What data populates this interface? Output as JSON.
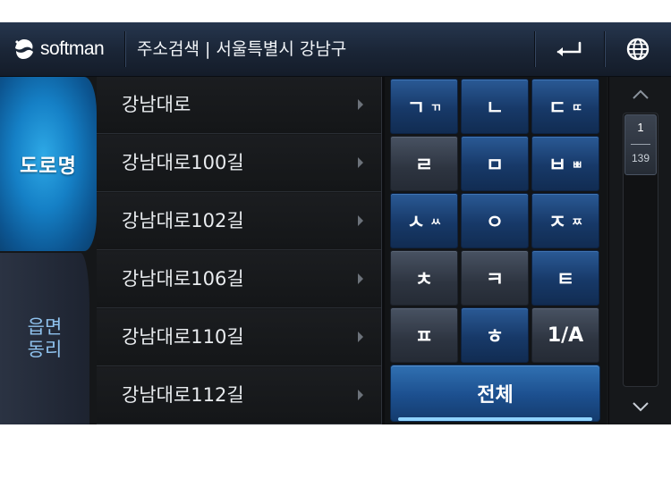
{
  "header": {
    "logo_text": "softman",
    "title": "주소검색 | 서울특별시 강남구",
    "back_icon": "back-arrow-icon",
    "globe_icon": "globe-icon"
  },
  "tabs": {
    "road": "도로명",
    "town": "읍면\n동리",
    "active": "road"
  },
  "list": {
    "items": [
      {
        "label": "강남대로"
      },
      {
        "label": "강남대로100길"
      },
      {
        "label": "강남대로102길"
      },
      {
        "label": "강남대로106길"
      },
      {
        "label": "강남대로110길"
      },
      {
        "label": "강남대로112길"
      }
    ]
  },
  "keypad": {
    "keys": [
      {
        "main": "ㄱ",
        "sub": "ㄲ",
        "style": "blue"
      },
      {
        "main": "ㄴ",
        "sub": "",
        "style": "blue"
      },
      {
        "main": "ㄷ",
        "sub": "ㄸ",
        "style": "blue"
      },
      {
        "main": "ㄹ",
        "sub": "",
        "style": "dark"
      },
      {
        "main": "ㅁ",
        "sub": "",
        "style": "blue"
      },
      {
        "main": "ㅂ",
        "sub": "ㅃ",
        "style": "blue"
      },
      {
        "main": "ㅅ",
        "sub": "ㅆ",
        "style": "blue"
      },
      {
        "main": "ㅇ",
        "sub": "",
        "style": "blue"
      },
      {
        "main": "ㅈ",
        "sub": "ㅉ",
        "style": "blue"
      },
      {
        "main": "ㅊ",
        "sub": "",
        "style": "dark"
      },
      {
        "main": "ㅋ",
        "sub": "",
        "style": "dark"
      },
      {
        "main": "ㅌ",
        "sub": "",
        "style": "blue"
      },
      {
        "main": "ㅍ",
        "sub": "",
        "style": "dark"
      },
      {
        "main": "ㅎ",
        "sub": "",
        "style": "blue"
      },
      {
        "main": "1/A",
        "sub": "",
        "style": "dark"
      }
    ],
    "all_label": "전체"
  },
  "scrollbar": {
    "current_page": "1",
    "total_pages": "139"
  },
  "colors": {
    "header_bg": "#1d2a3d",
    "active_tab": "#1580c6",
    "key_blue": "#1c4679",
    "key_dark": "#343b47",
    "accent": "#8fd3ff"
  }
}
